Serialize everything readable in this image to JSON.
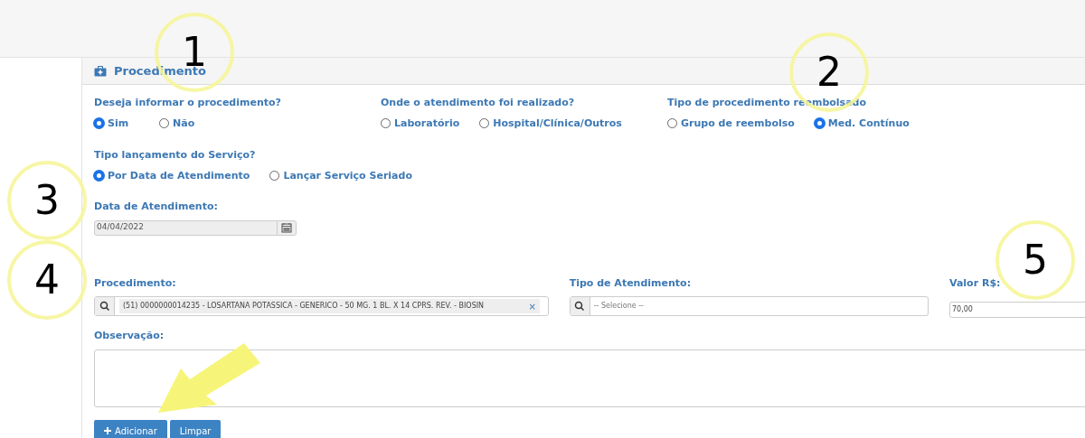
{
  "panel": {
    "title": "Procedimento"
  },
  "radio_rows": [
    [
      {
        "label": "Deseja informar o procedimento?",
        "options": [
          {
            "label": "Sim",
            "selected": true
          },
          {
            "label": "Não",
            "selected": false
          }
        ]
      },
      {
        "label": "Onde o atendimento foi realizado?",
        "options": [
          {
            "label": "Laboratório",
            "selected": false
          },
          {
            "label": "Hospital/Clínica/Outros",
            "selected": false
          }
        ]
      },
      {
        "label": "Tipo de procedimento reembolsado",
        "options": [
          {
            "label": "Grupo de reembolso",
            "selected": false
          },
          {
            "label": "Med. Contínuo",
            "selected": true
          }
        ]
      }
    ],
    [
      {
        "label": "Tipo lançamento do Serviço?",
        "options": [
          {
            "label": "Por Data de Atendimento",
            "selected": true
          },
          {
            "label": "Lançar Serviço Seriado",
            "selected": false
          }
        ]
      }
    ]
  ],
  "date_field": {
    "label": "Data de Atendimento:",
    "value": "04/04/2022"
  },
  "procedimento": {
    "label": "Procedimento:",
    "value": "(51) 0000000014235 - LOSARTANA POTASSICA - GENERICO - 50 MG. 1 BL. X 14 CPRS. REV. - BIOSIN",
    "clear": "×"
  },
  "tipo_atendimento": {
    "label": "Tipo de Atendimento:",
    "placeholder": "-- Selecione --"
  },
  "valor": {
    "label": "Valor R$:",
    "value": "70,00"
  },
  "observacao": {
    "label": "Observação:"
  },
  "buttons": [
    {
      "label": "Adicionar",
      "kind": "add"
    },
    {
      "label": "Limpar",
      "kind": "plain"
    }
  ],
  "annotations": [
    {
      "label": "1"
    },
    {
      "label": "2"
    },
    {
      "label": "3"
    },
    {
      "label": "4"
    },
    {
      "label": "5"
    }
  ]
}
